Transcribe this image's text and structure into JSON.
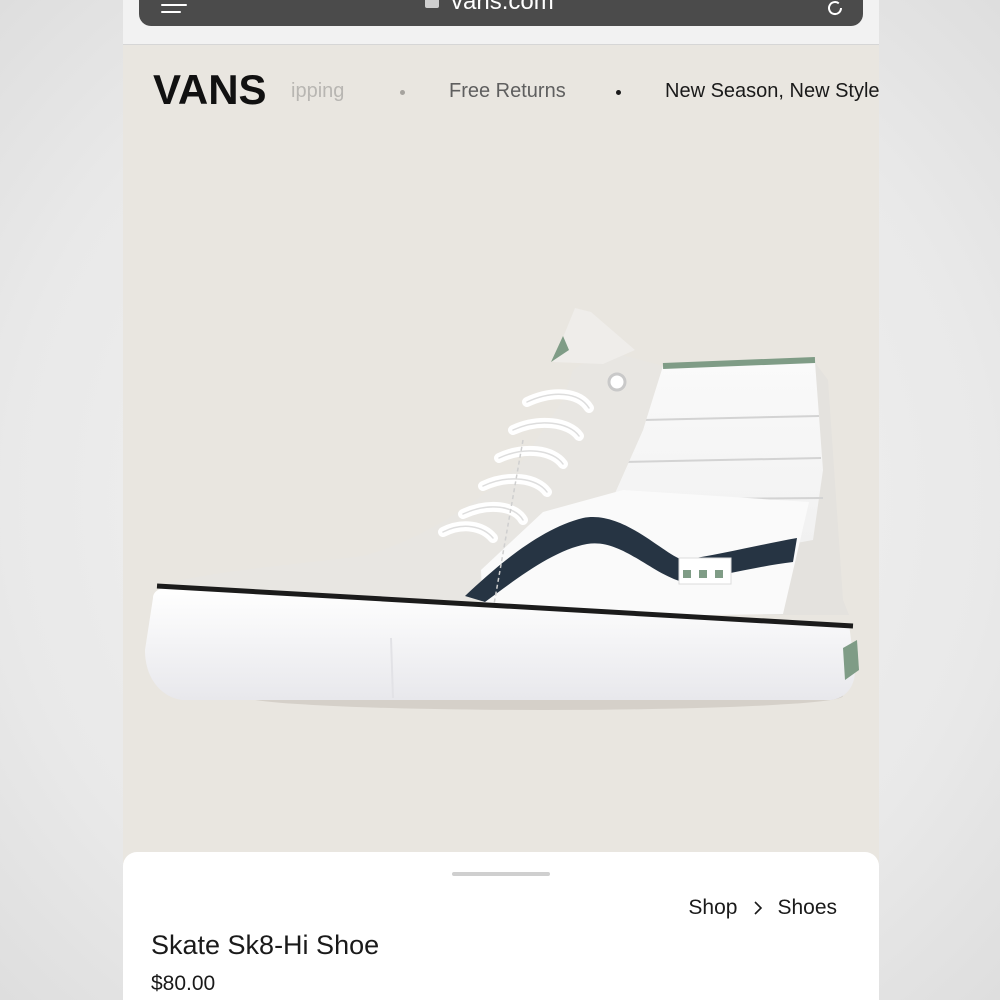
{
  "browser": {
    "url": "vans.com"
  },
  "promo": {
    "brand": "VANS",
    "items": [
      "ipping",
      "Free Returns",
      "New Season, New Style"
    ]
  },
  "hero": {
    "image_alt": "Skate Sk8-Hi Shoe",
    "colors": {
      "background": "#e9e6e0",
      "shoe_white": "#f7f7f7",
      "suede": "#e8e6e2",
      "stripe": "#263443",
      "collar_accent": "#7f9c86"
    }
  },
  "product": {
    "breadcrumb": [
      "Shop",
      "Shoes"
    ],
    "title": "Skate Sk8-Hi Shoe",
    "price": "$80.00"
  }
}
